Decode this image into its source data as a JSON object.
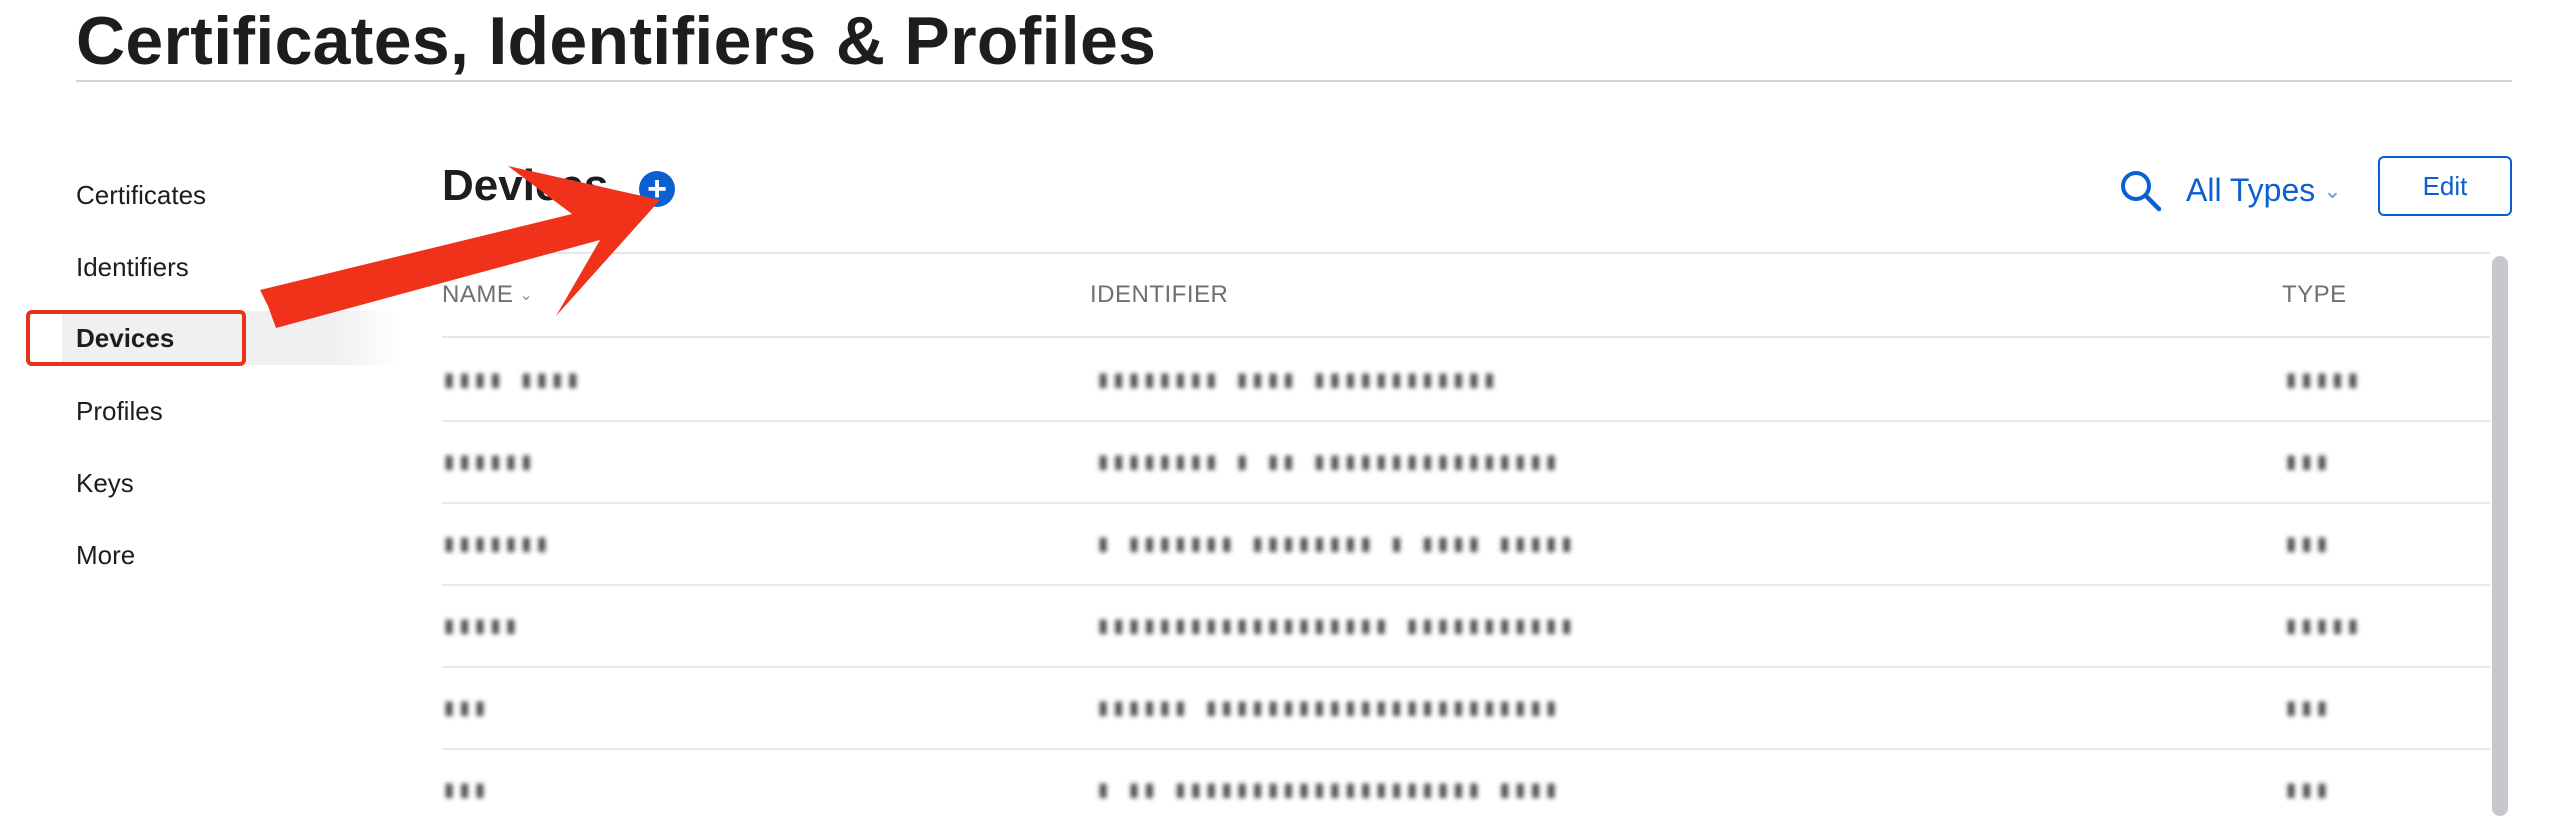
{
  "page_title": "Certificates, Identifiers & Profiles",
  "sidebar": {
    "items": [
      {
        "label": "Certificates",
        "active": false
      },
      {
        "label": "Identifiers",
        "active": false
      },
      {
        "label": "Devices",
        "active": true
      },
      {
        "label": "Profiles",
        "active": false
      },
      {
        "label": "Keys",
        "active": false
      },
      {
        "label": "More",
        "active": false
      }
    ]
  },
  "main": {
    "section_title": "Devices",
    "add_button_label": "+",
    "type_filter": {
      "selected": "All Types"
    },
    "edit_label": "Edit",
    "icons": {
      "search": "search-icon",
      "add": "plus-circle-icon",
      "chevron": "chevron-down-icon"
    }
  },
  "table": {
    "columns": [
      {
        "label": "NAME",
        "sortable": true
      },
      {
        "label": "IDENTIFIER",
        "sortable": false
      },
      {
        "label": "TYPE",
        "sortable": false
      }
    ],
    "rows": [
      {
        "name": "▮▮▮▮ ▮▮▮▮",
        "identifier": "▮▮▮▮▮▮▮▮ ▮▮▮▮ ▮▮▮▮▮▮▮▮▮▮▮▮",
        "type": "▮▮▮▮▮"
      },
      {
        "name": "▮▮▮▮▮▮",
        "identifier": "▮▮▮▮▮▮▮▮ ▮ ▮▮ ▮▮▮▮▮▮▮▮▮▮▮▮▮▮▮▮",
        "type": "▮▮▮"
      },
      {
        "name": "▮▮▮▮▮▮▮",
        "identifier": "▮ ▮▮▮▮▮▮▮ ▮▮▮▮▮▮▮▮ ▮ ▮▮▮▮ ▮▮▮▮▮",
        "type": "▮▮▮"
      },
      {
        "name": "▮▮▮▮▮",
        "identifier": "▮▮▮▮▮▮▮▮▮▮▮▮▮▮▮▮▮▮▮ ▮▮▮▮▮▮▮▮▮▮▮",
        "type": "▮▮▮▮▮"
      },
      {
        "name": "▮▮▮",
        "identifier": "▮▮▮▮▮▮ ▮▮▮▮▮▮▮▮▮▮▮▮▮▮▮▮▮▮▮▮▮▮▮",
        "type": "▮▮▮"
      },
      {
        "name": "▮▮▮",
        "identifier": "▮ ▮▮ ▮▮▮▮▮▮▮▮▮▮▮▮▮▮▮▮▮▮▮▮ ▮▮▮▮",
        "type": "▮▮▮"
      }
    ]
  },
  "colors": {
    "accent": "#0b5fd0",
    "annotation": "#e8321c"
  }
}
